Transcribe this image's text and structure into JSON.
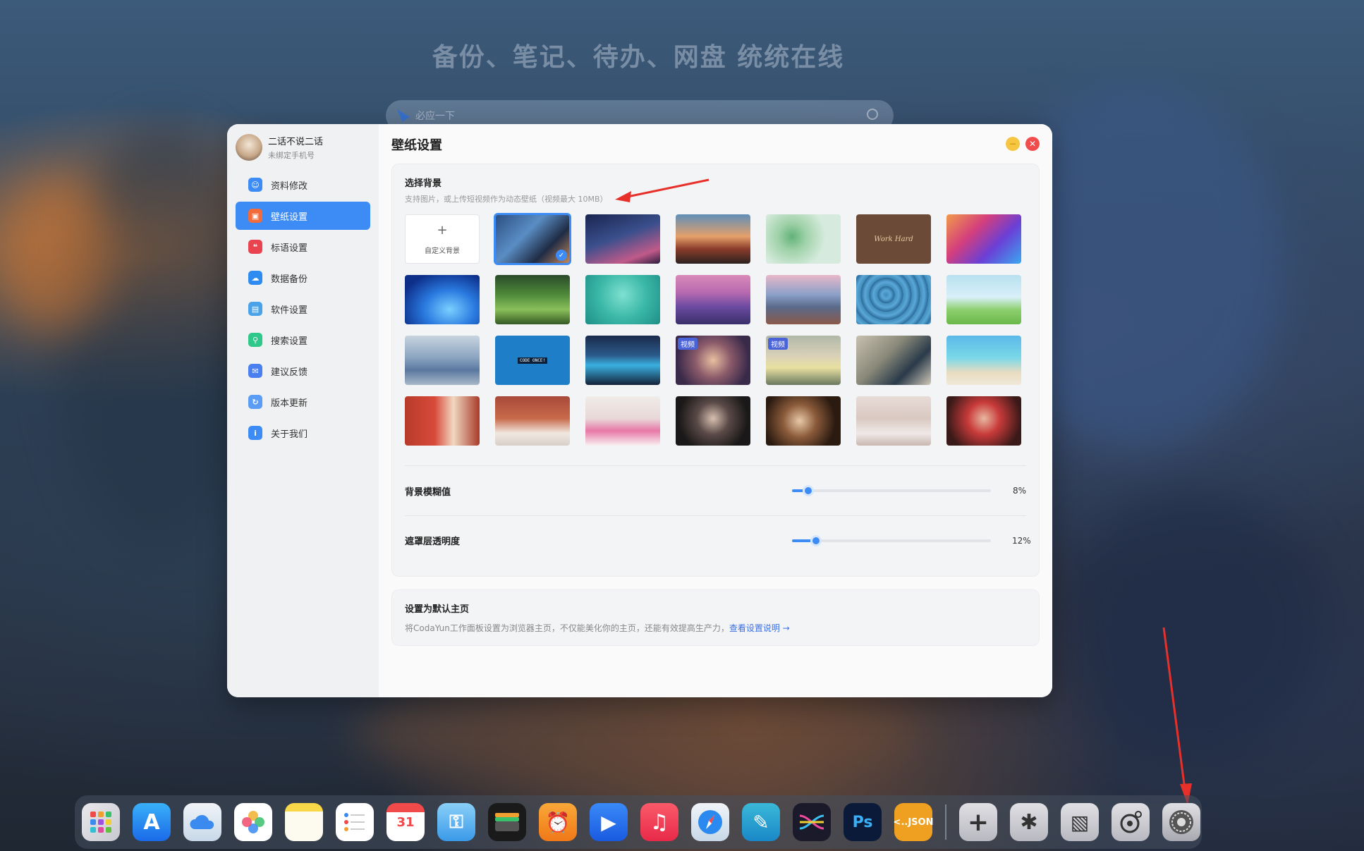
{
  "background": {
    "headline": "备份、笔记、待办、网盘 统统在线",
    "search_placeholder": "必应一下"
  },
  "user": {
    "name": "二话不说二话",
    "subtitle": "未绑定手机号"
  },
  "sidebar": {
    "items": [
      {
        "label": "资料修改",
        "icon": "user-edit-icon",
        "color": "#3d8cf5"
      },
      {
        "label": "壁纸设置",
        "icon": "wallpaper-icon",
        "color": "#f26b3a",
        "active": true
      },
      {
        "label": "标语设置",
        "icon": "quote-icon",
        "color": "#e8434f"
      },
      {
        "label": "数据备份",
        "icon": "cloud-icon",
        "color": "#2e8cf0"
      },
      {
        "label": "软件设置",
        "icon": "monitor-icon",
        "color": "#4aa3e8"
      },
      {
        "label": "搜索设置",
        "icon": "search-icon",
        "color": "#2fc78a"
      },
      {
        "label": "建议反馈",
        "icon": "feedback-icon",
        "color": "#4a7ff0"
      },
      {
        "label": "版本更新",
        "icon": "update-icon",
        "color": "#5b9cf5"
      },
      {
        "label": "关于我们",
        "icon": "info-icon",
        "color": "#3d8cf5"
      }
    ]
  },
  "main": {
    "title": "壁纸设置",
    "background_section": {
      "title": "选择背景",
      "subtitle": "支持图片，或上传短视频作为动态壁纸（视频最大 10MB）",
      "custom_label": "自定义背景",
      "custom_plus": "+",
      "video_badge": "视频",
      "code_text": "CODE ONCE!",
      "work_text": "Work Hard"
    },
    "sliders": [
      {
        "label": "背景模糊值",
        "value_text": "8%",
        "value": 0.08
      },
      {
        "label": "遮罩层透明度",
        "value_text": "12%",
        "value": 0.12
      }
    ],
    "default_home": {
      "title": "设置为默认主页",
      "desc": "将CodaYun工作面板设置为浏览器主页，不仅能美化你的主页，还能有效提高生产力，",
      "link": "查看设置说明 →"
    }
  },
  "colors": {
    "accent": "#3d8cf5",
    "close": "#f24d4d",
    "minimize": "#f6c542"
  }
}
